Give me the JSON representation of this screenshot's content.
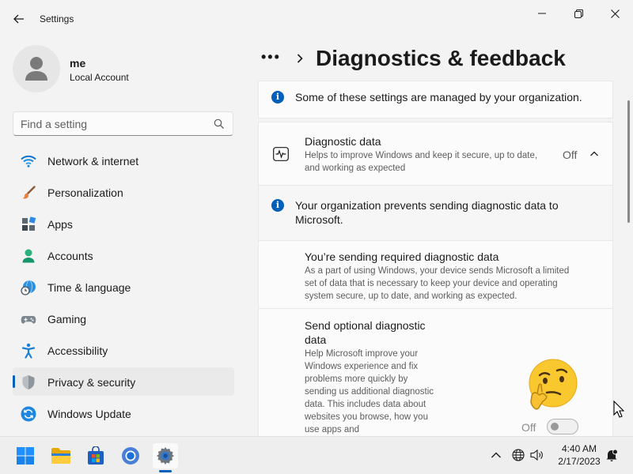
{
  "window": {
    "title": "Settings",
    "controls": {
      "minimize": "minimize-icon",
      "maximize": "maximize-icon",
      "close": "close-icon"
    }
  },
  "profile": {
    "name": "me",
    "account_type": "Local Account"
  },
  "search": {
    "placeholder": "Find a setting",
    "value": ""
  },
  "sidebar": {
    "items": [
      {
        "label": "Network & internet",
        "icon": "wifi-icon",
        "selected": false
      },
      {
        "label": "Personalization",
        "icon": "brush-icon",
        "selected": false
      },
      {
        "label": "Apps",
        "icon": "apps-icon",
        "selected": false
      },
      {
        "label": "Accounts",
        "icon": "person-icon",
        "selected": false
      },
      {
        "label": "Time & language",
        "icon": "globe-clock-icon",
        "selected": false
      },
      {
        "label": "Gaming",
        "icon": "gamepad-icon",
        "selected": false
      },
      {
        "label": "Accessibility",
        "icon": "accessibility-icon",
        "selected": false
      },
      {
        "label": "Privacy & security",
        "icon": "shield-icon",
        "selected": true
      },
      {
        "label": "Windows Update",
        "icon": "update-icon",
        "selected": false
      }
    ]
  },
  "header": {
    "more": "•••",
    "title": "Diagnostics & feedback"
  },
  "notice": {
    "text": "Some of these settings are managed by your organization."
  },
  "diagnostic": {
    "title": "Diagnostic data",
    "description": "Helps to improve Windows and keep it secure, up to date, and working as expected",
    "state": "Off",
    "org_notice": "Your organization prevents sending diagnostic data to Microsoft.",
    "required_title": "You’re sending required diagnostic data",
    "required_desc": "As a part of using Windows, your device sends Microsoft a limited set of data that is necessary to keep your device and operating system secure, up to date, and working as expected.",
    "optional_title": "Send optional diagnostic data",
    "optional_desc": "Help Microsoft improve your Windows experience and fix problems more quickly by sending us additional diagnostic data. This includes data about websites you browse, how you use apps and",
    "optional_state": "Off",
    "optional_on": false
  },
  "taskbar": {
    "apps": [
      "start-icon",
      "file-explorer-icon",
      "store-icon",
      "chrome-icon",
      "settings-icon"
    ],
    "time": "4:40 AM",
    "date": "2/17/2023"
  },
  "colors": {
    "accent": "#005fb8",
    "background": "#f3f3f3",
    "card": "#fbfbfb"
  }
}
